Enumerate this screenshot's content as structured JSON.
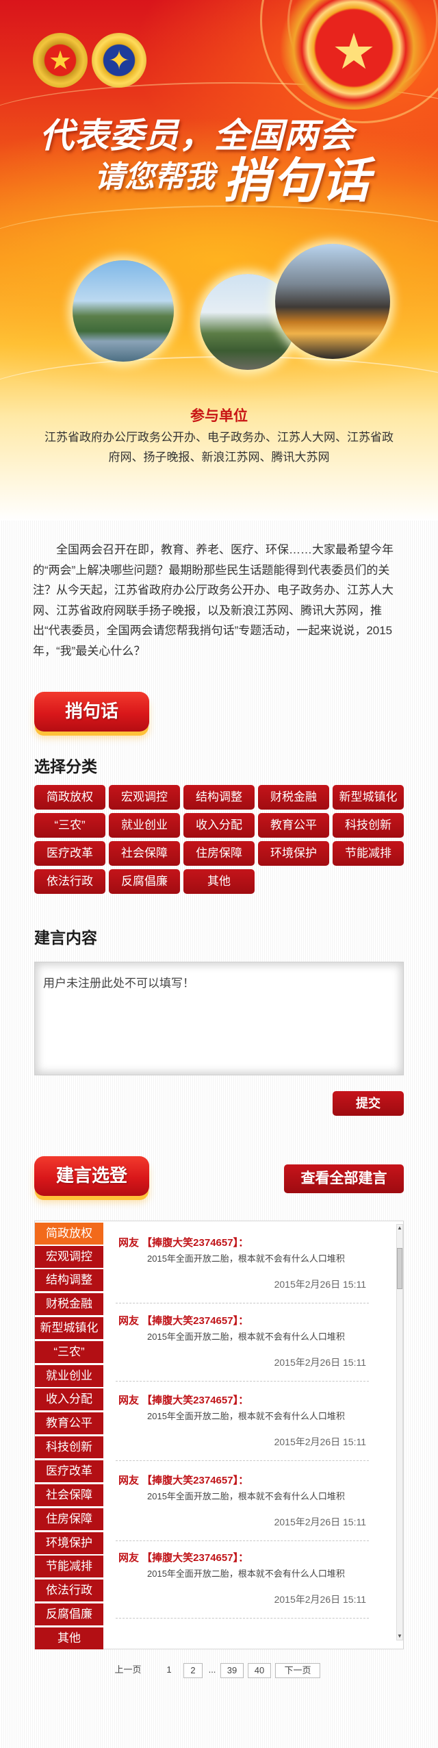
{
  "header": {
    "title_line1": "代表委员，全国两会",
    "title_line2": "请您帮我",
    "title_line3": "捎句话",
    "emblem_icons": [
      "national-emblem-icon",
      "cppcc-emblem-icon",
      "star-emblem-icon"
    ]
  },
  "units": {
    "title": "参与单位",
    "text": "江苏省政府办公厅政务公开办、电子政务办、江苏人大网、江苏省政府网、扬子晚报、新浪江苏网、腾讯大苏网"
  },
  "intro": "全国两会召开在即，教育、养老、医疗、环保……大家最希望今年的“两会”上解决哪些问题？最期盼那些民生话题能得到代表委员们的关注？从今天起，江苏省政府办公厅政务公开办、电子政务办、江苏人大网、江苏省政府网联手扬子晚报，以及新浪江苏网、腾讯大苏网，推出“代表委员，全国两会请您帮我捎句话”专题活动，一起来说说，2015年，“我”最关心什么？",
  "message_section": {
    "pill_label": "捎句话",
    "category_heading": "选择分类",
    "categories": [
      "简政放权",
      "宏观调控",
      "结构调整",
      "财税金融",
      "新型城镇化",
      "“三农”",
      "就业创业",
      "收入分配",
      "教育公平",
      "科技创新",
      "医疗改革",
      "社会保障",
      "住房保障",
      "环境保护",
      "节能减排",
      "依法行政",
      "反腐倡廉",
      "其他"
    ],
    "content_heading": "建言内容",
    "textarea_value": "用户未注册此处不可以填写！",
    "submit_label": "提交"
  },
  "selection_section": {
    "pill_label": "建言选登",
    "view_all_label": "查看全部建言",
    "tabs": [
      "简政放权",
      "宏观调控",
      "结构调整",
      "财税金融",
      "新型城镇化",
      "“三农”",
      "就业创业",
      "收入分配",
      "教育公平",
      "科技创新",
      "医疗改革",
      "社会保障",
      "住房保障",
      "环境保护",
      "节能减排",
      "依法行政",
      "反腐倡廉",
      "其他"
    ],
    "active_tab": "简政放权",
    "messages": [
      {
        "who": "网友 【捧腹大笑2374657】：",
        "body": "2015年全面开放二胎，根本就不会有什么人口堆积",
        "date": "2015年2月26日 15:11"
      },
      {
        "who": "网友 【捧腹大笑2374657】：",
        "body": "2015年全面开放二胎，根本就不会有什么人口堆积",
        "date": "2015年2月26日 15:11"
      },
      {
        "who": "网友 【捧腹大笑2374657】：",
        "body": "2015年全面开放二胎，根本就不会有什么人口堆积",
        "date": "2015年2月26日 15:11"
      },
      {
        "who": "网友 【捧腹大笑2374657】：",
        "body": "2015年全面开放二胎，根本就不会有什么人口堆积",
        "date": "2015年2月26日 15:11"
      },
      {
        "who": "网友 【捧腹大笑2374657】：",
        "body": "2015年全面开放二胎，根本就不会有什么人口堆积",
        "date": "2015年2月26日 15:11"
      }
    ]
  },
  "pagination": {
    "prev": "上一页",
    "pages": [
      "1",
      "2",
      "39",
      "40"
    ],
    "ellipsis": "...",
    "next": "下一页",
    "current_page": "1"
  },
  "colors": {
    "brand_red": "#b30f14",
    "active_orange": "#f26a1b",
    "accent_gold": "#ffc23a"
  }
}
